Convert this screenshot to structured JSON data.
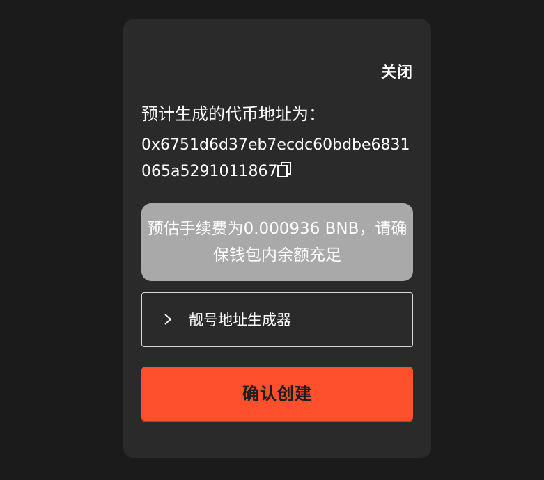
{
  "dialog": {
    "close_label": "关闭",
    "address_label": "预计生成的代币地址为：",
    "address_value": "0x6751d6d37eb7ecdc60bdbe6831065a5291011867",
    "copy_icon": "copy-icon",
    "fee_notice": "预估手续费为0.000936 BNB，请确保钱包内余额充足",
    "generator_label": "靓号地址生成器",
    "generator_icon": "chevron-right-icon",
    "confirm_label": "确认创建"
  },
  "colors": {
    "background": "#1b1b1b",
    "panel": "#2a2a2a",
    "fee_box": "#a9a9a9",
    "accent": "#ff502d"
  }
}
